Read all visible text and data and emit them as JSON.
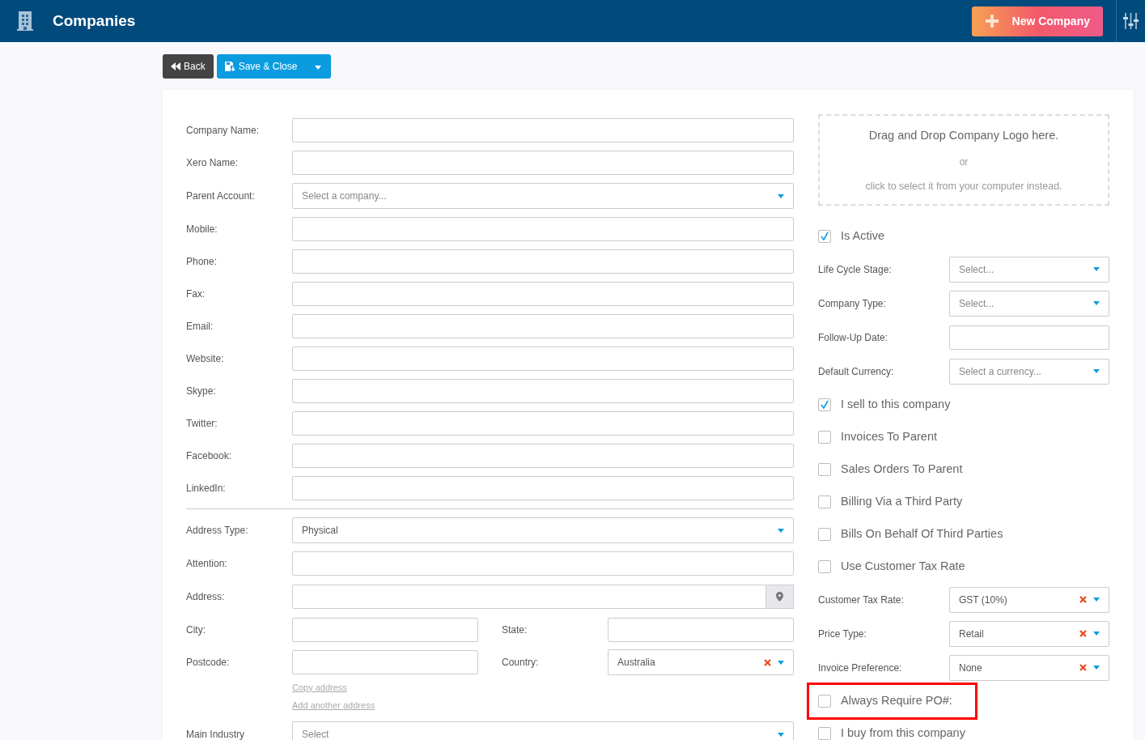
{
  "header": {
    "title": "Companies",
    "new_button": "New Company"
  },
  "toolbar": {
    "back": "Back",
    "save": "Save & Close"
  },
  "left_fields": [
    {
      "kind": "input",
      "label": "Company Name:"
    },
    {
      "kind": "input",
      "label": "Xero Name:"
    },
    {
      "kind": "select",
      "label": "Parent Account:",
      "placeholder": "Select a company..."
    },
    {
      "kind": "input",
      "label": "Mobile:"
    },
    {
      "kind": "input",
      "label": "Phone:"
    },
    {
      "kind": "input",
      "label": "Fax:"
    },
    {
      "kind": "input",
      "label": "Email:"
    },
    {
      "kind": "input",
      "label": "Website:"
    },
    {
      "kind": "input",
      "label": "Skype:"
    },
    {
      "kind": "input",
      "label": "Twitter:"
    },
    {
      "kind": "input",
      "label": "Facebook:"
    },
    {
      "kind": "input",
      "label": "LinkedIn:"
    },
    {
      "kind": "divider"
    },
    {
      "kind": "select",
      "label": "Address Type:",
      "value": "Physical"
    },
    {
      "kind": "input",
      "label": "Attention:"
    },
    {
      "kind": "address",
      "label": "Address:"
    },
    {
      "kind": "pair",
      "fields": [
        {
          "kind": "input",
          "label": "City:"
        },
        {
          "kind": "input",
          "label": "State:"
        }
      ]
    },
    {
      "kind": "pair",
      "fields": [
        {
          "kind": "input",
          "label": "Postcode:"
        },
        {
          "kind": "select",
          "label": "Country:",
          "value": "Australia",
          "clearable": true
        }
      ]
    },
    {
      "kind": "link",
      "text": "Copy address"
    },
    {
      "kind": "link",
      "text": "Add another address"
    },
    {
      "kind": "select",
      "label": "Main Industry",
      "placeholder": "Select"
    }
  ],
  "dropzone": {
    "title": "Drag and Drop Company Logo here.",
    "or": "or",
    "hint": "click to select it from your computer instead."
  },
  "right_fields": [
    {
      "kind": "checkbox",
      "label": "Is Active",
      "checked": true,
      "highlighted": false
    },
    {
      "kind": "select",
      "label": "Life Cycle Stage:",
      "placeholder": "Select..."
    },
    {
      "kind": "select",
      "label": "Company Type:",
      "placeholder": "Select..."
    },
    {
      "kind": "input",
      "label": "Follow-Up Date:"
    },
    {
      "kind": "select",
      "label": "Default Currency:",
      "placeholder": "Select a currency..."
    },
    {
      "kind": "checkbox",
      "label": "I sell to this company",
      "checked": true,
      "highlighted": false
    },
    {
      "kind": "checkbox",
      "label": "Invoices To Parent",
      "checked": false,
      "highlighted": false
    },
    {
      "kind": "checkbox",
      "label": "Sales Orders To Parent",
      "checked": false,
      "highlighted": false
    },
    {
      "kind": "checkbox",
      "label": "Billing Via a Third Party",
      "checked": false,
      "highlighted": false
    },
    {
      "kind": "checkbox",
      "label": "Bills On Behalf Of Third Parties",
      "checked": false,
      "highlighted": false
    },
    {
      "kind": "checkbox",
      "label": "Use Customer Tax Rate",
      "checked": false,
      "highlighted": false
    },
    {
      "kind": "select",
      "label": "Customer Tax Rate:",
      "value": "GST (10%)",
      "clearable": true
    },
    {
      "kind": "select",
      "label": "Price Type:",
      "value": "Retail",
      "clearable": true
    },
    {
      "kind": "select",
      "label": "Invoice Preference:",
      "value": "None",
      "clearable": true
    },
    {
      "kind": "checkbox",
      "label": "Always Require PO#:",
      "checked": false,
      "highlighted": true
    },
    {
      "kind": "checkbox",
      "label": "I buy from this company",
      "checked": false,
      "highlighted": false
    }
  ]
}
